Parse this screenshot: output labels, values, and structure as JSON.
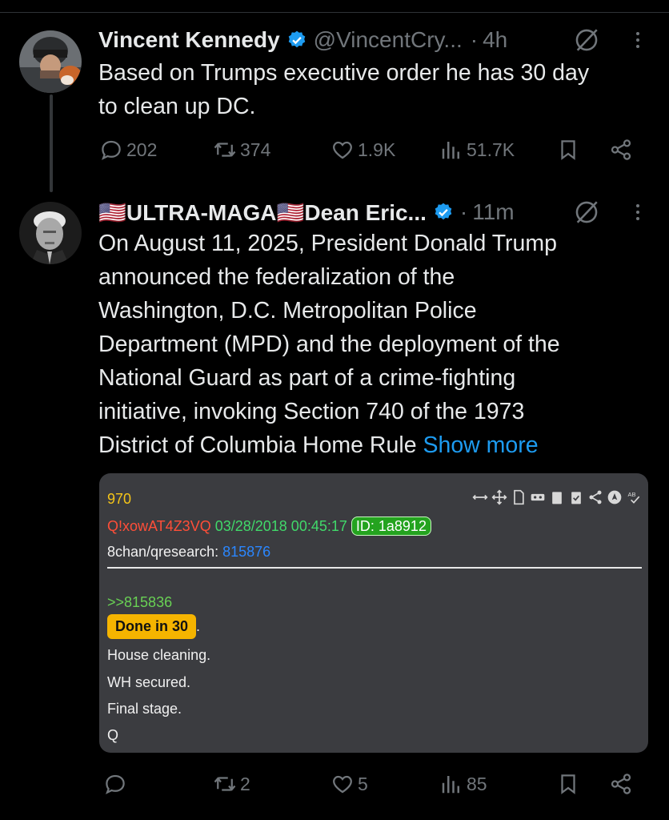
{
  "tweet1": {
    "name": "Vincent Kennedy",
    "handle": "@VincentCry...",
    "separator": "·",
    "time": "4h",
    "text_line1": "Based on Trumps executive order he has 30 day",
    "text_line2": "to clean up DC.",
    "actions": {
      "replies": "202",
      "reposts": "374",
      "likes": "1.9K",
      "views": "51.7K"
    }
  },
  "tweet2": {
    "name": "🇺🇸ULTRA-MAGA🇺🇸Dean Eric...",
    "separator": "·",
    "time": "11m",
    "lines": [
      "On August 11, 2025, President Donald Trump",
      "announced the federalization of the",
      "Washington, D.C. Metropolitan Police",
      "Department (MPD) and the deployment of the",
      "National Guard as part of a crime-fighting",
      "initiative, invoking Section 740 of the 1973",
      "District of Columbia Home Rule "
    ],
    "show_more": "Show more",
    "actions": {
      "replies": "",
      "reposts": "2",
      "likes": "5",
      "views": "85"
    }
  },
  "qpost": {
    "number": "970",
    "tripcode": "Q!xowAT4Z3VQ",
    "datetime": "03/28/2018 00:45:17",
    "id": "ID: 1a8912",
    "board": "8chan/qresearch:",
    "post_no": "815876",
    "quote_link": ">>815836",
    "highlight": "Done in 30",
    "after_highlight": ".",
    "line1": "House cleaning.",
    "line2": "WH secured.",
    "line3": "Final stage.",
    "line4": "Q"
  },
  "colors": {
    "background": "#000000",
    "text": "#e7e9ea",
    "muted": "#71767b",
    "link": "#1d9bf0",
    "card": "#3b3c40",
    "highlight": "#f5b400"
  }
}
